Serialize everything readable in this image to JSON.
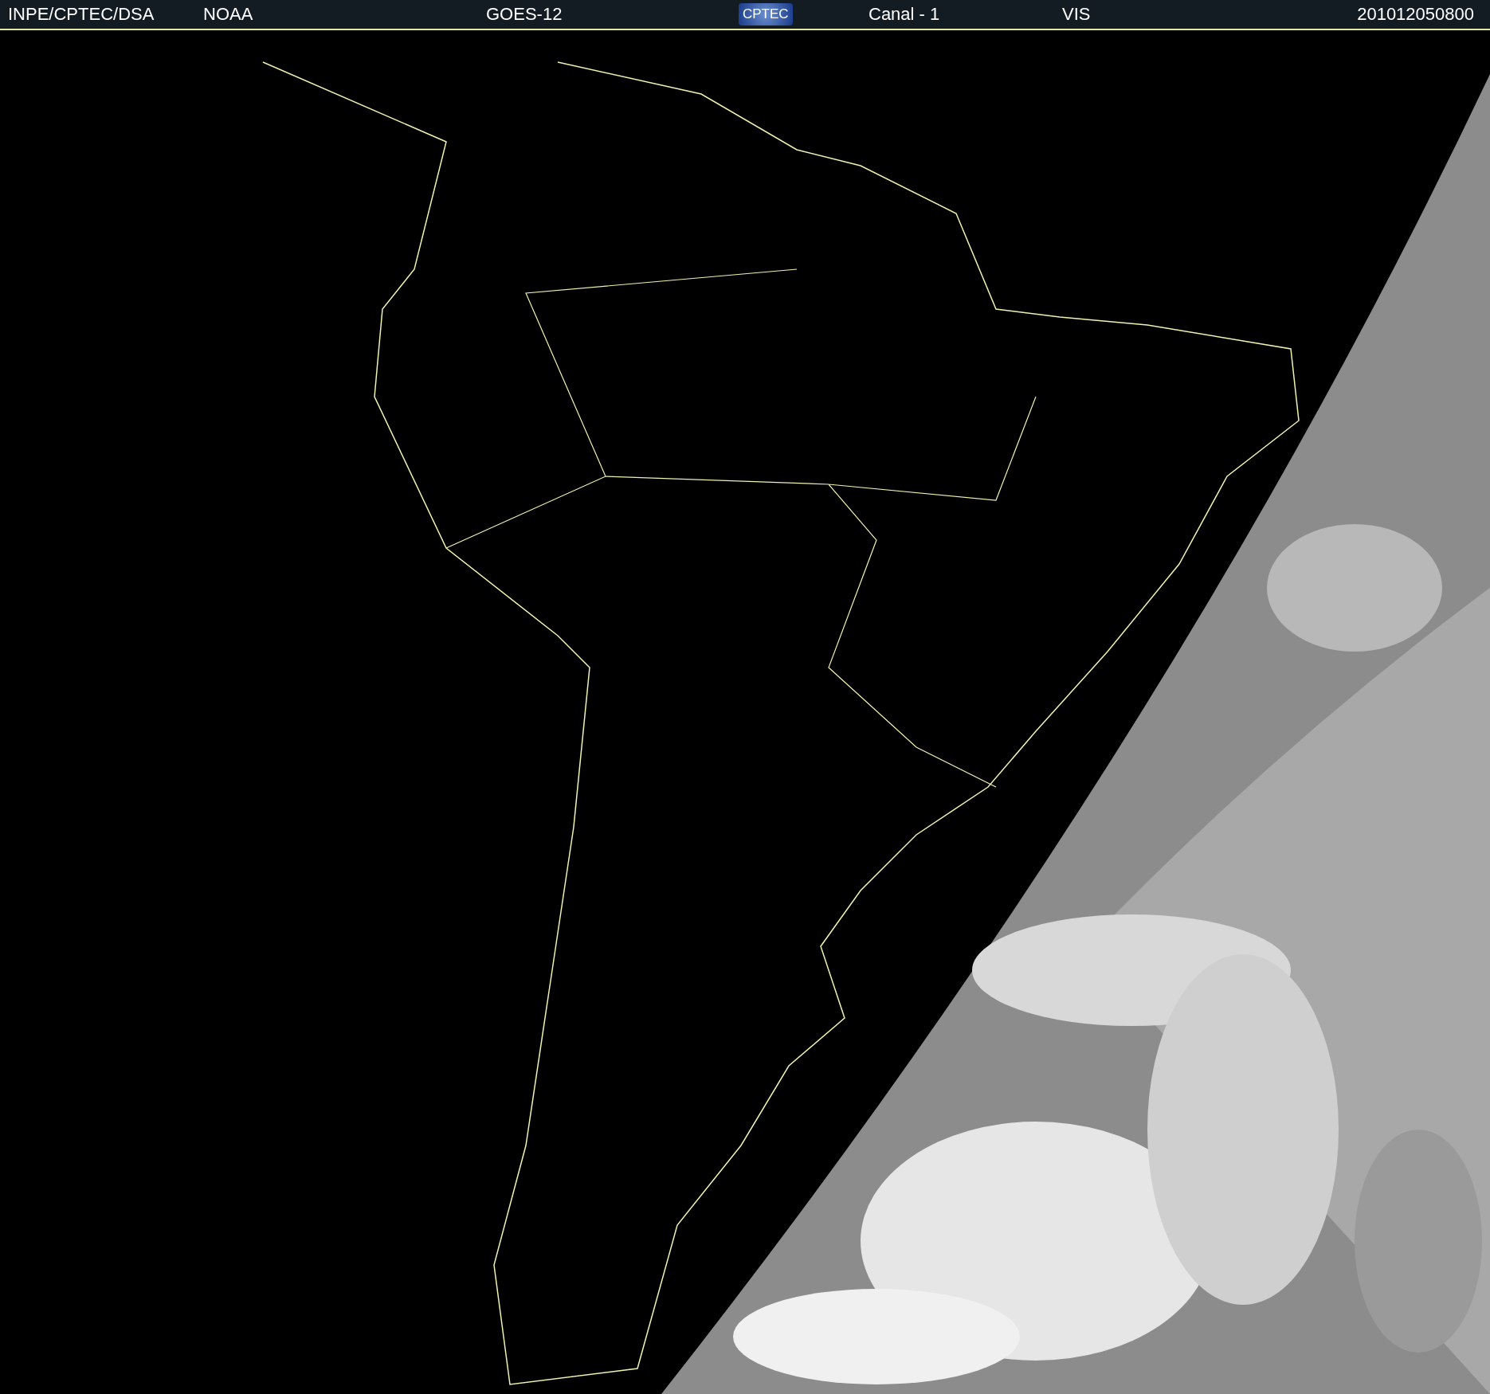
{
  "header": {
    "items": [
      {
        "kind": "text",
        "text": "INPE/CPTEC/DSA"
      },
      {
        "kind": "text",
        "text": "NOAA"
      },
      {
        "kind": "text",
        "text": "GOES-12"
      },
      {
        "kind": "logo",
        "text": "CPTEC"
      },
      {
        "kind": "text",
        "text": "Canal - 1"
      },
      {
        "kind": "text",
        "text": "VIS"
      },
      {
        "kind": "text",
        "text": "201012050800"
      }
    ]
  }
}
